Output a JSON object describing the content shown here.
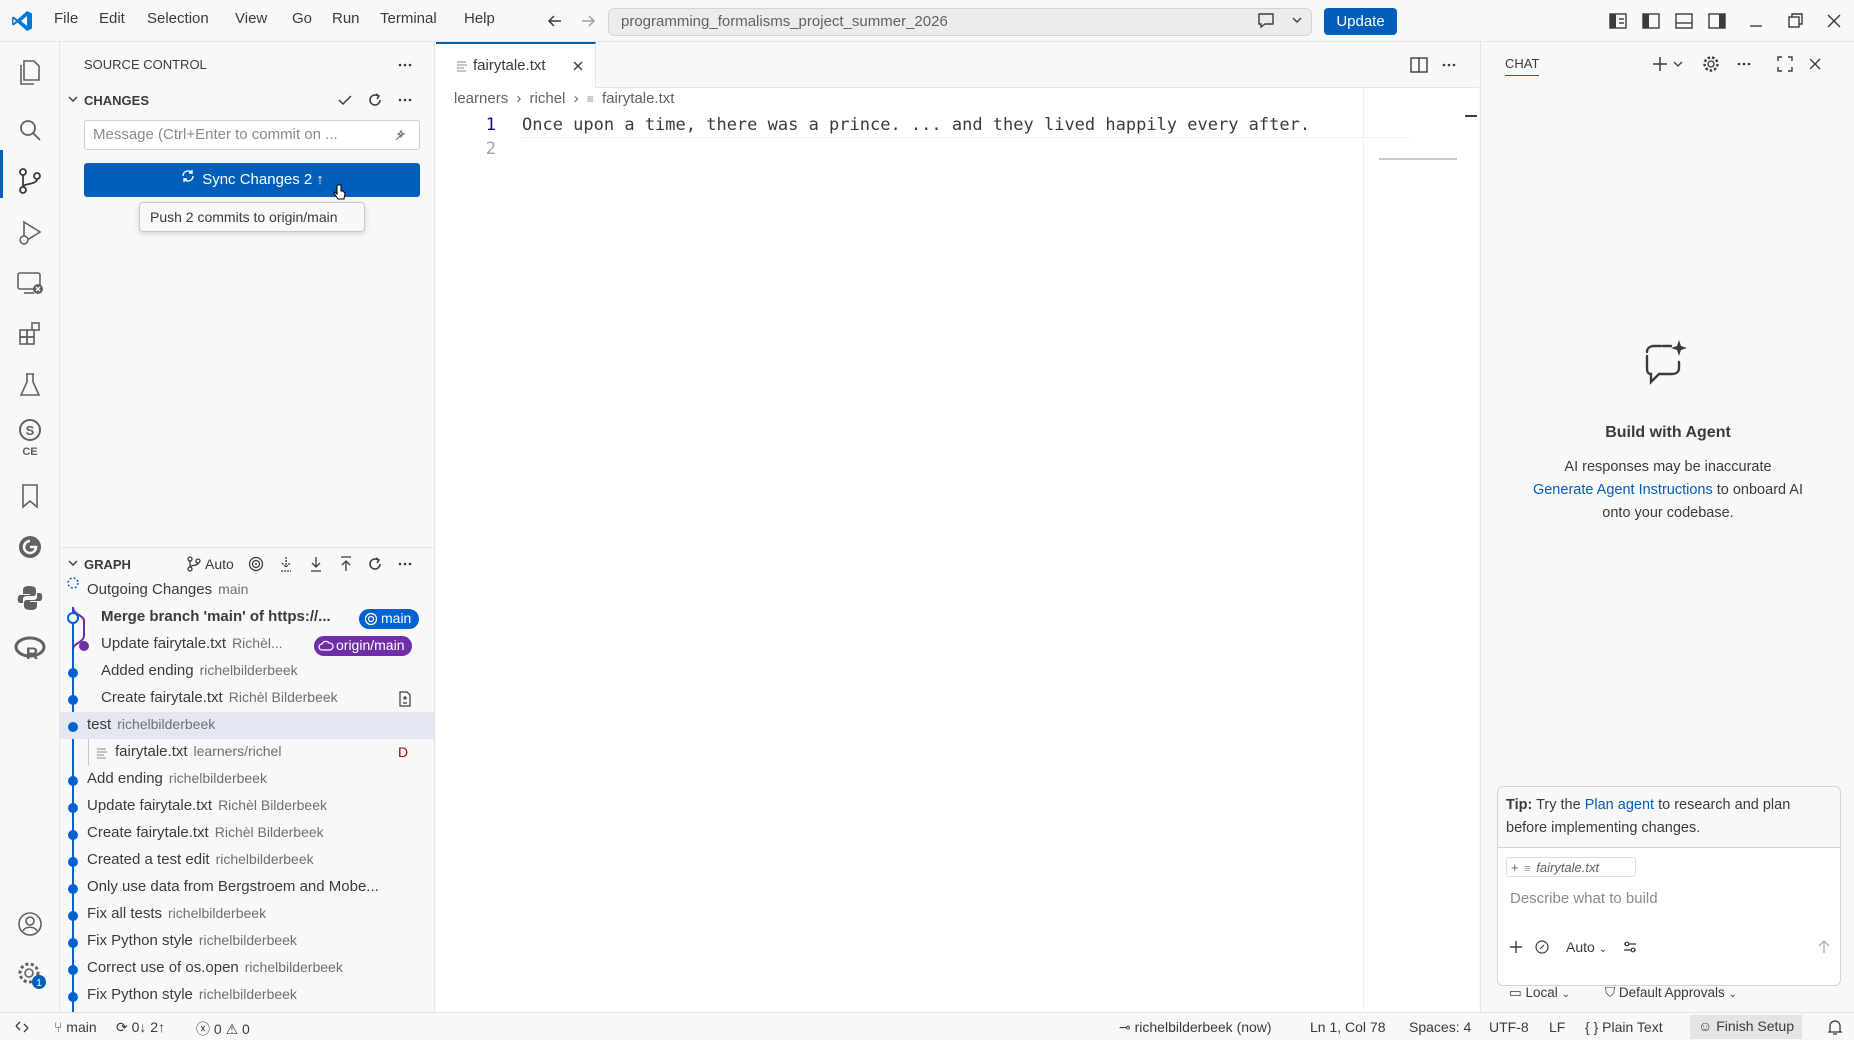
{
  "menu": [
    "File",
    "Edit",
    "Selection",
    "View",
    "Go",
    "Run",
    "Terminal",
    "Help"
  ],
  "search": {
    "text": "programming_formalisms_project_summer_2026"
  },
  "update_label": "Update",
  "sidebar": {
    "title": "SOURCE CONTROL",
    "changes_title": "CHANGES",
    "commit_placeholder": "Message (Ctrl+Enter to commit on ...",
    "sync_label": "Sync Changes 2",
    "tooltip": "Push 2 commits to origin/main",
    "graph_title": "GRAPH",
    "graph_auto": "Auto",
    "outgoing": {
      "label": "Outgoing Changes",
      "branch": "main"
    },
    "commits": [
      {
        "msg": "Merge branch 'main' of https://...",
        "author": "",
        "badge": "main",
        "bold": true
      },
      {
        "msg": "Update fairytale.txt",
        "author": "Richèl...",
        "badge": "origin/main"
      },
      {
        "msg": "Added ending",
        "author": "richelbilderbeek"
      },
      {
        "msg": "Create fairytale.txt",
        "author": "Richèl Bilderbeek"
      },
      {
        "msg": "test",
        "author": "richelbilderbeek"
      },
      {
        "msg": "fairytale.txt",
        "author": "learners/richel",
        "status": "D"
      },
      {
        "msg": "Add ending",
        "author": "richelbilderbeek"
      },
      {
        "msg": "Update fairytale.txt",
        "author": "Richèl Bilderbeek"
      },
      {
        "msg": "Create fairytale.txt",
        "author": "Richèl Bilderbeek"
      },
      {
        "msg": "Created a test edit",
        "author": "richelbilderbeek"
      },
      {
        "msg": "Only use data from Bergstroem and Mobe...",
        "author": ""
      },
      {
        "msg": "Fix all tests",
        "author": "richelbilderbeek"
      },
      {
        "msg": "Fix Python style",
        "author": "richelbilderbeek"
      },
      {
        "msg": "Correct use of os.open",
        "author": "richelbilderbeek"
      },
      {
        "msg": "Fix Python style",
        "author": "richelbilderbeek"
      }
    ]
  },
  "editor": {
    "tab_label": "fairytale.txt",
    "breadcrumb": [
      "learners",
      "richel",
      "fairytale.txt"
    ],
    "lines": [
      {
        "num": "1",
        "text": "Once upon a time, there was a prince. ... and they lived happily every after."
      },
      {
        "num": "2",
        "text": ""
      }
    ]
  },
  "chat": {
    "title": "CHAT",
    "heading": "Build with Agent",
    "line1": "AI responses may be inaccurate",
    "link": "Generate Agent Instructions",
    "line2_rest": " to onboard AI",
    "line3": "onto your codebase.",
    "tip_bold": "Tip:",
    "tip_pre": " Try the ",
    "tip_link": "Plan agent",
    "tip_post": " to research and plan",
    "tip_line2": "before implementing changes.",
    "attachment": "fairytale.txt",
    "input_placeholder": "Describe what to build",
    "mode": "Auto",
    "location": "Local",
    "approvals": "Default Approvals"
  },
  "status": {
    "branch": "main",
    "sync": "0↓ 2↑",
    "errors": "0",
    "warnings": "0",
    "blame": "richelbilderbeek (now)",
    "position": "Ln 1, Col 78",
    "spaces": "Spaces: 4",
    "encoding": "UTF-8",
    "eol": "LF",
    "language": "Plain Text",
    "finish": "Finish Setup"
  },
  "colors": {
    "accent": "#005fb8",
    "graph_blue": "#0062d1",
    "graph_purple": "#6f2da8"
  }
}
